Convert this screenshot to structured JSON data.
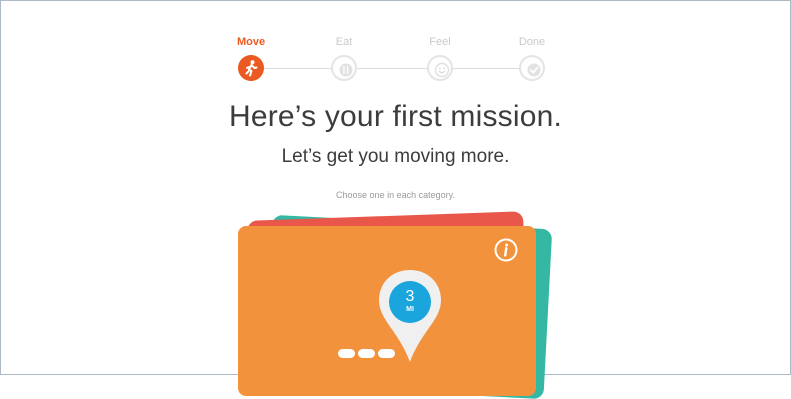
{
  "stepper": {
    "steps": [
      {
        "label": "Move",
        "state": "active",
        "icon": "running-person-icon"
      },
      {
        "label": "Eat",
        "state": "inactive",
        "icon": "plate-icon"
      },
      {
        "label": "Feel",
        "state": "inactive",
        "icon": "smiley-icon"
      },
      {
        "label": "Done",
        "state": "inactive",
        "icon": "checkmark-icon"
      }
    ]
  },
  "heading": {
    "title": "Here’s your first mission.",
    "subtitle": "Let’s get you moving more.",
    "hint": "Choose one in each category."
  },
  "card": {
    "goal_value": "3",
    "goal_unit": "MI",
    "colors": {
      "front": "#f3923c",
      "back_red": "#e8574a",
      "back_teal": "#35b8a3",
      "pin": "#1aa5dd"
    },
    "progress_dots": 3
  },
  "colors": {
    "accent": "#ec5a24",
    "text": "#3c3c3c",
    "inactive": "#c9c9c9"
  }
}
